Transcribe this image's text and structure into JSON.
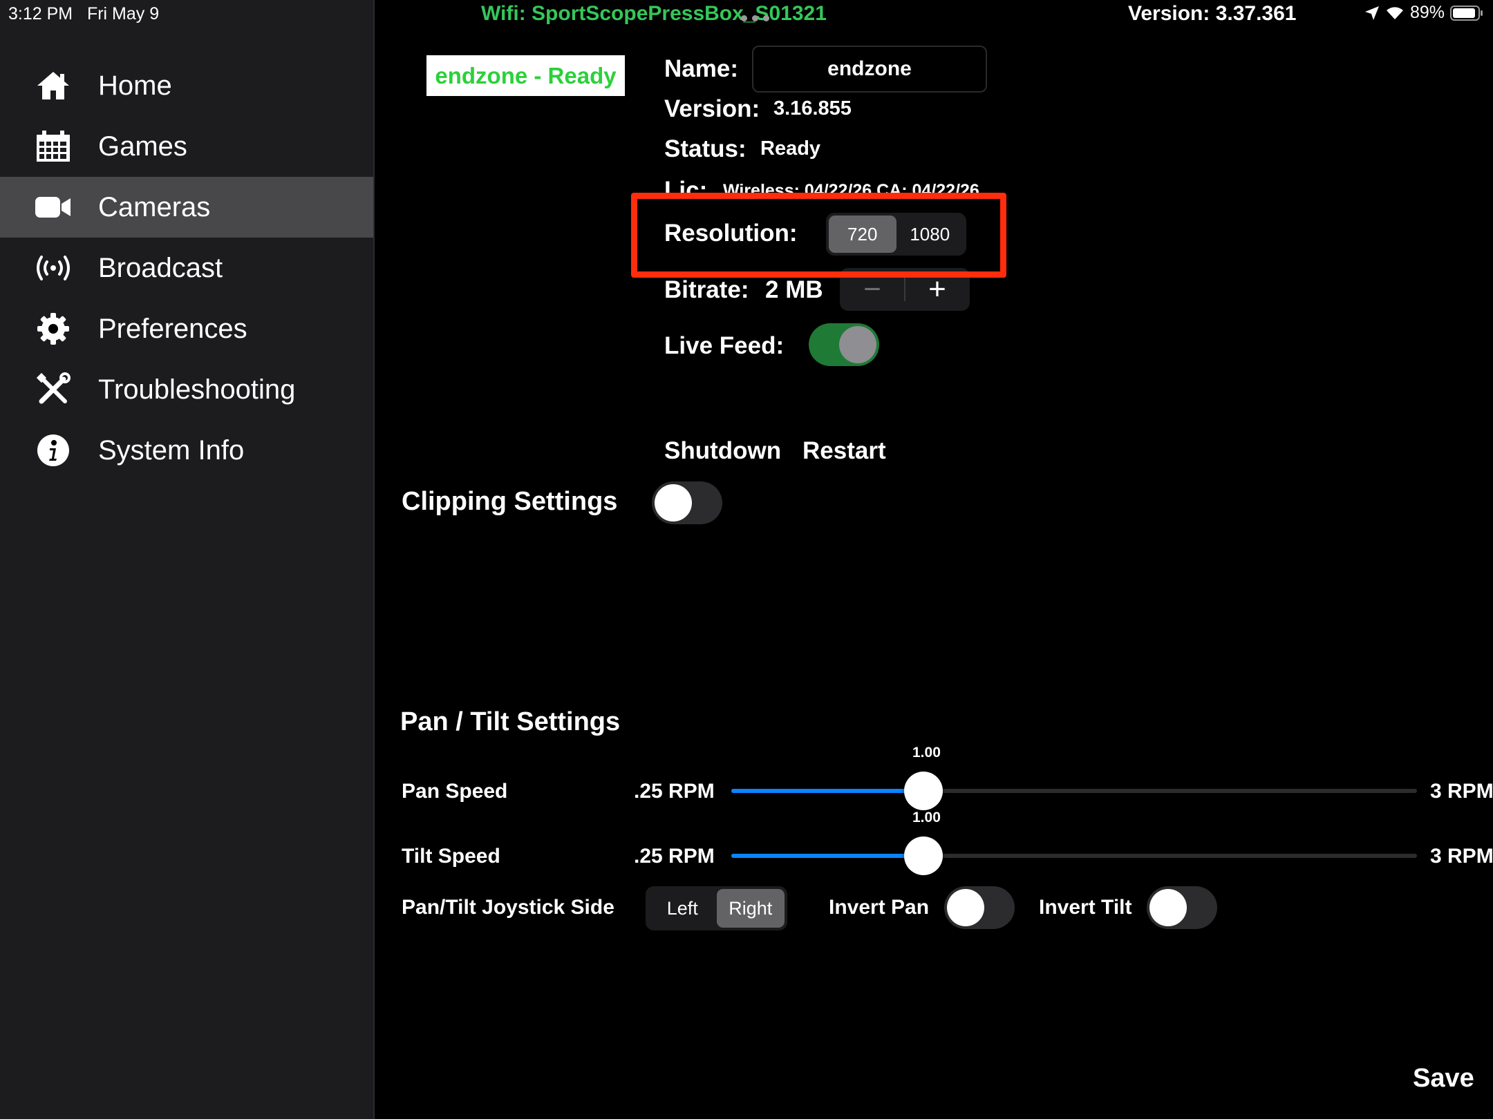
{
  "status_bar": {
    "time": "3:12 PM",
    "date": "Fri May 9",
    "wifi": "Wifi: SportScopePressBox_S01321",
    "app_version": "Version: 3.37.361",
    "battery": "89%"
  },
  "sidebar": {
    "items": [
      {
        "label": "Home",
        "icon": "home-icon"
      },
      {
        "label": "Games",
        "icon": "calendar-icon"
      },
      {
        "label": "Cameras",
        "icon": "video-camera-icon",
        "active": true
      },
      {
        "label": "Broadcast",
        "icon": "broadcast-icon"
      },
      {
        "label": "Preferences",
        "icon": "gear-icon"
      },
      {
        "label": "Troubleshooting",
        "icon": "tools-icon"
      },
      {
        "label": "System Info",
        "icon": "info-icon"
      }
    ]
  },
  "camera": {
    "badge": "endzone - Ready",
    "name_label": "Name:",
    "name_value": "endzone",
    "version_label": "Version:",
    "version_value": "3.16.855",
    "status_label": "Status:",
    "status_value": "Ready",
    "lic_label": "Lic:",
    "lic_value": "Wireless: 04/22/26 CA: 04/22/26",
    "resolution_label": "Resolution:",
    "resolution_options": [
      "720",
      "1080"
    ],
    "resolution_selected": "720",
    "bitrate_label": "Bitrate:",
    "bitrate_value": "2 MB",
    "stepper_minus": "−",
    "stepper_plus": "+",
    "live_feed_label": "Live Feed:",
    "live_feed_on": true,
    "shutdown_label": "Shutdown",
    "restart_label": "Restart"
  },
  "clipping": {
    "title": "Clipping Settings",
    "enabled": false
  },
  "pan_tilt": {
    "title": "Pan / Tilt Settings",
    "pan_speed_label": "Pan Speed",
    "tilt_speed_label": "Tilt Speed",
    "min_label": ".25 RPM",
    "max_label": "3 RPM",
    "pan_value": "1.00",
    "tilt_value": "1.00",
    "slider_fraction": 0.28,
    "joystick_label": "Pan/Tilt Joystick Side",
    "joystick_options": [
      "Left",
      "Right"
    ],
    "joystick_selected": "Right",
    "invert_pan_label": "Invert Pan",
    "invert_pan_on": false,
    "invert_tilt_label": "Invert Tilt",
    "invert_tilt_on": false
  },
  "save_label": "Save",
  "colors": {
    "ready_green": "#2bd13a",
    "wifi_green": "#34c759",
    "highlight_red": "#ff2d0c",
    "slider_blue": "#0a84ff",
    "toggle_on_green": "#1f7a36"
  }
}
